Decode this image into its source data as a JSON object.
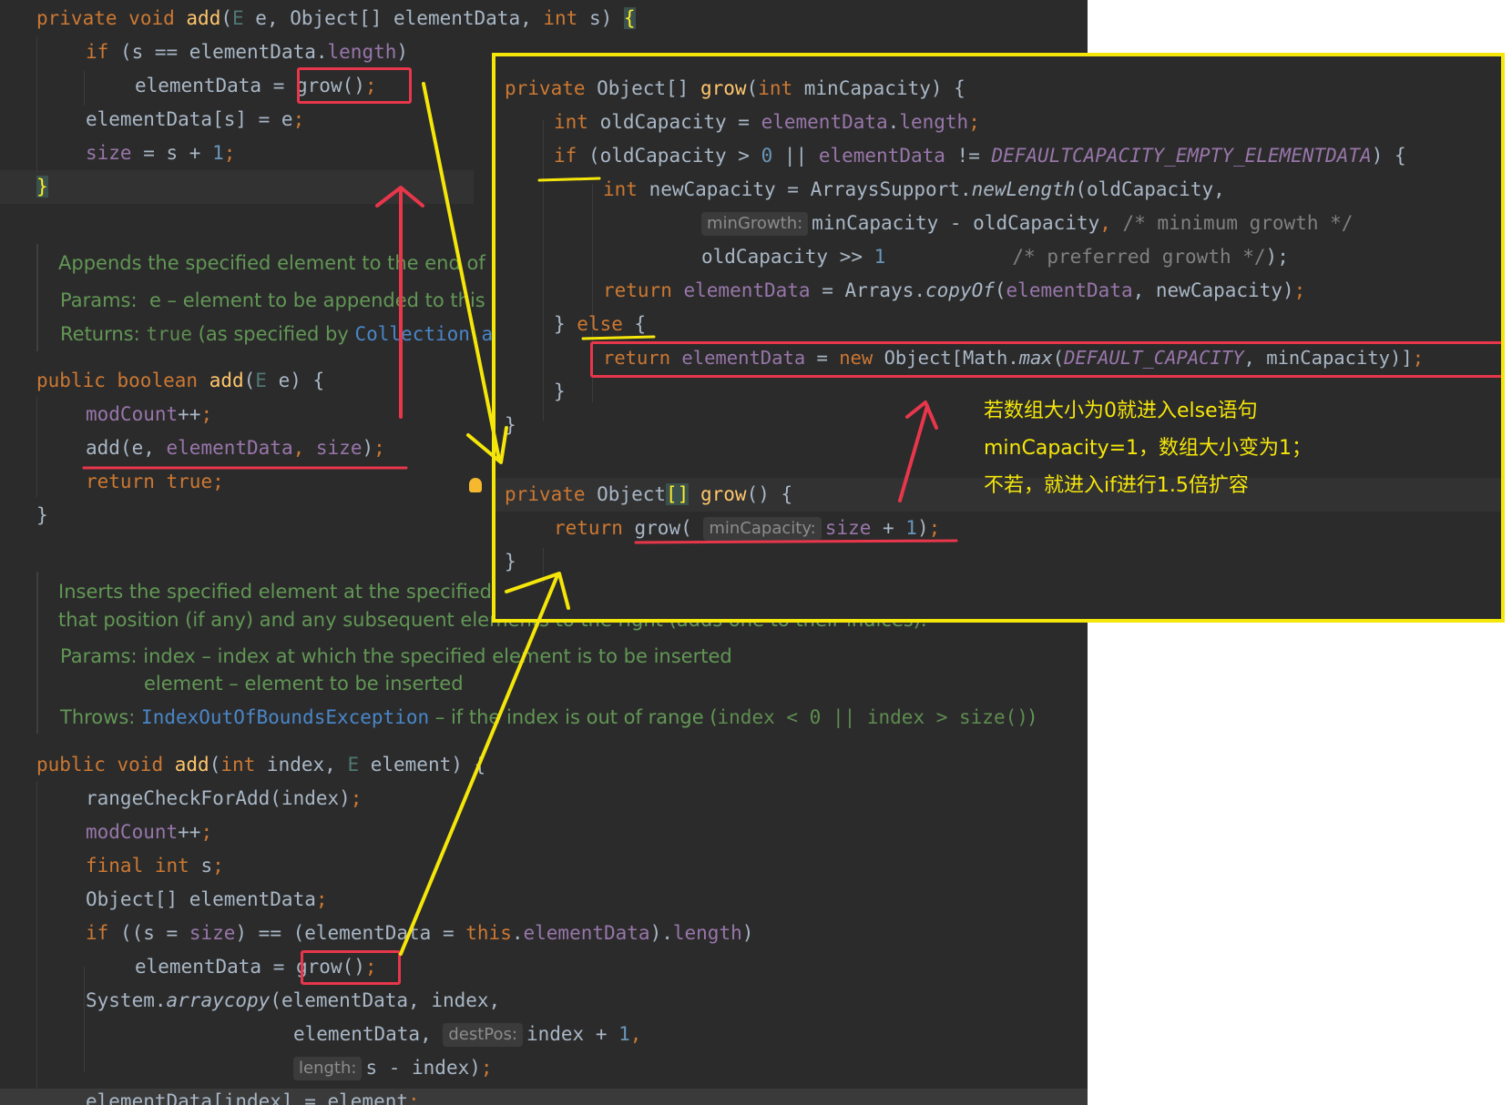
{
  "method1": {
    "sig_mod": "private",
    "sig_void": "void",
    "sig_name": "add",
    "sig_params_a": "(",
    "sig_type_param": "E",
    "sig_params_b": " e, Object[] elementData, ",
    "sig_int": "int",
    "sig_params_c": " s) ",
    "sig_brace": "{",
    "if_kw": "if",
    "if_a": " (s == elementData.",
    "if_len": "length",
    "if_b": ")",
    "assign_a": "elementData = ",
    "assign_grow": "grow()",
    "assign_semi": ";",
    "set_a": "elementData[s] = e",
    "set_semi": ";",
    "size_fld": "size",
    "size_a": " = s + ",
    "size_num": "1",
    "size_semi": ";",
    "close": "}"
  },
  "doc1": {
    "summary": "Appends the specified element to the end of this list.",
    "params_label": "Params:",
    "params_text": "e – element to be appended to this list",
    "returns_label": "Returns:",
    "returns_code": "true",
    "returns_text": " (as specified by ",
    "returns_link": "Collection.add"
  },
  "method2": {
    "sig_mod": "public",
    "sig_bool": "boolean",
    "sig_name": "add",
    "sig_a": "(",
    "sig_tp": "E",
    "sig_b": " e) {",
    "modcount": "modCount",
    "modcount_op": "++",
    "modcount_semi": ";",
    "call_name": "add",
    "call_a": "(e, ",
    "call_fld1": "elementData",
    "call_b": ", ",
    "call_fld2": "size",
    "call_c": ")",
    "call_semi": ";",
    "ret_kw": "return",
    "ret_true": "true",
    "ret_semi": ";",
    "close": "}"
  },
  "doc2": {
    "summary1": "Inserts the specified element at the specified position in this list. Shifts the element currently at",
    "summary2": "that position (if any) and any subsequent elements to the right (adds one to their indices).",
    "params_label": "Params:",
    "params_line1": "index – index at which the specified element is to be inserted",
    "params_line2": "element – element to be inserted",
    "throws_label": "Throws:",
    "throws_link": "IndexOutOfBoundsException",
    "throws_text": " – if the index is out of range (",
    "throws_code": "index < 0 || index > size()",
    "throws_end": ")"
  },
  "method3": {
    "sig_mod": "public",
    "sig_void": "void",
    "sig_name": "add",
    "sig_a": "(",
    "sig_int": "int",
    "sig_b": " index, ",
    "sig_tp": "E",
    "sig_c": " element) {",
    "l1": "rangeCheckForAdd(index)",
    "l1_semi": ";",
    "l2": "modCount",
    "l2_op": "++",
    "l2_semi": ";",
    "l3_final": "final",
    "l3_int": "int",
    "l3_b": " s",
    "l3_semi": ";",
    "l4": "Object[] elementData",
    "l4_semi": ";",
    "l5_if": "if",
    "l5_a": " ((s = ",
    "l5_size": "size",
    "l5_b": ") == (elementData = ",
    "l5_this": "this",
    "l5_dot": ".",
    "l5_fld": "elementData",
    "l5_c": ").",
    "l5_len": "length",
    "l5_d": ")",
    "l6_a": "elementData = ",
    "l6_grow": "grow()",
    "l6_semi": ";",
    "l7_a": "System.",
    "l7_fn": "arraycopy",
    "l7_b": "(elementData, index,",
    "l8_a": "elementData, ",
    "l8_hint": "destPos:",
    "l8_b": "index + ",
    "l8_num": "1",
    "l8_c": ",",
    "l9_hint": "length:",
    "l9_b": "s - index)",
    "l9_semi": ";",
    "l10": "elementData[index] = element",
    "l10_semi": ";"
  },
  "grow1": {
    "sig_mod": "private",
    "sig_a": " Object[] ",
    "sig_name": "grow",
    "sig_b": "(",
    "sig_int": "int",
    "sig_c": " minCapacity) {",
    "l1_int": "int",
    "l1_a": " oldCapacity = ",
    "l1_fld": "elementData",
    "l1_dot": ".",
    "l1_len": "length",
    "l1_semi": ";",
    "l2_if": "if",
    "l2_a": " (oldCapacity > ",
    "l2_num": "0",
    "l2_b": " || ",
    "l2_fld": "elementData",
    "l2_c": " != ",
    "l2_const": "DEFAULTCAPACITY_EMPTY_ELEMENTDATA",
    "l2_d": ") {",
    "l3_int": "int",
    "l3_a": " newCapacity = ArraysSupport.",
    "l3_fn": "newLength",
    "l3_b": "(oldCapacity,",
    "l4_hint": "minGrowth:",
    "l4_a": "minCapacity - oldCapacity",
    "l4_comma": ",",
    "l4_cmt": " /* minimum growth */",
    "l5_a": "oldCapacity >> ",
    "l5_num": "1",
    "l5_cmt": "           /* preferred growth */",
    "l5_b": ");",
    "l6_ret": "return",
    "l6_fld": " elementData",
    "l6_a": " = Arrays.",
    "l6_fn": "copyOf",
    "l6_b": "(",
    "l6_fld2": "elementData",
    "l6_c": ", newCapacity)",
    "l6_semi": ";",
    "l7_a": "} ",
    "l7_else": "else",
    "l7_b": " {",
    "l8_ret": "return",
    "l8_fld": " elementData",
    "l8_a": " = ",
    "l8_new": "new",
    "l8_b": " Object[Math.",
    "l8_fn": "max",
    "l8_c": "(",
    "l8_const": "DEFAULT_CAPACITY",
    "l8_d": ", minCapacity)]",
    "l8_semi": ";",
    "l9": "}",
    "l10": "}"
  },
  "grow0": {
    "sig_mod": "private",
    "sig_a": " Object",
    "sig_br": "[]",
    "sig_sp": " ",
    "sig_name": "grow",
    "sig_b": "() {",
    "l1_ret": "return",
    "l1_sp": " ",
    "l1_name": "grow",
    "l1_a": "( ",
    "l1_hint": "minCapacity:",
    "l1_size": "size",
    "l1_b": " + ",
    "l1_num": "1",
    "l1_c": ")",
    "l1_semi": ";",
    "close": "}"
  },
  "annotation": {
    "line1": "若数组大小为0就进入else语句",
    "line2": "minCapacity=1，数组大小变为1；",
    "line3": "不若，就进入if进行1.5倍扩容"
  },
  "colors": {
    "editor_bg": "#2b2b2b",
    "highlight_yellow": "#f5e60a",
    "annotation_red": "#e8364b"
  }
}
